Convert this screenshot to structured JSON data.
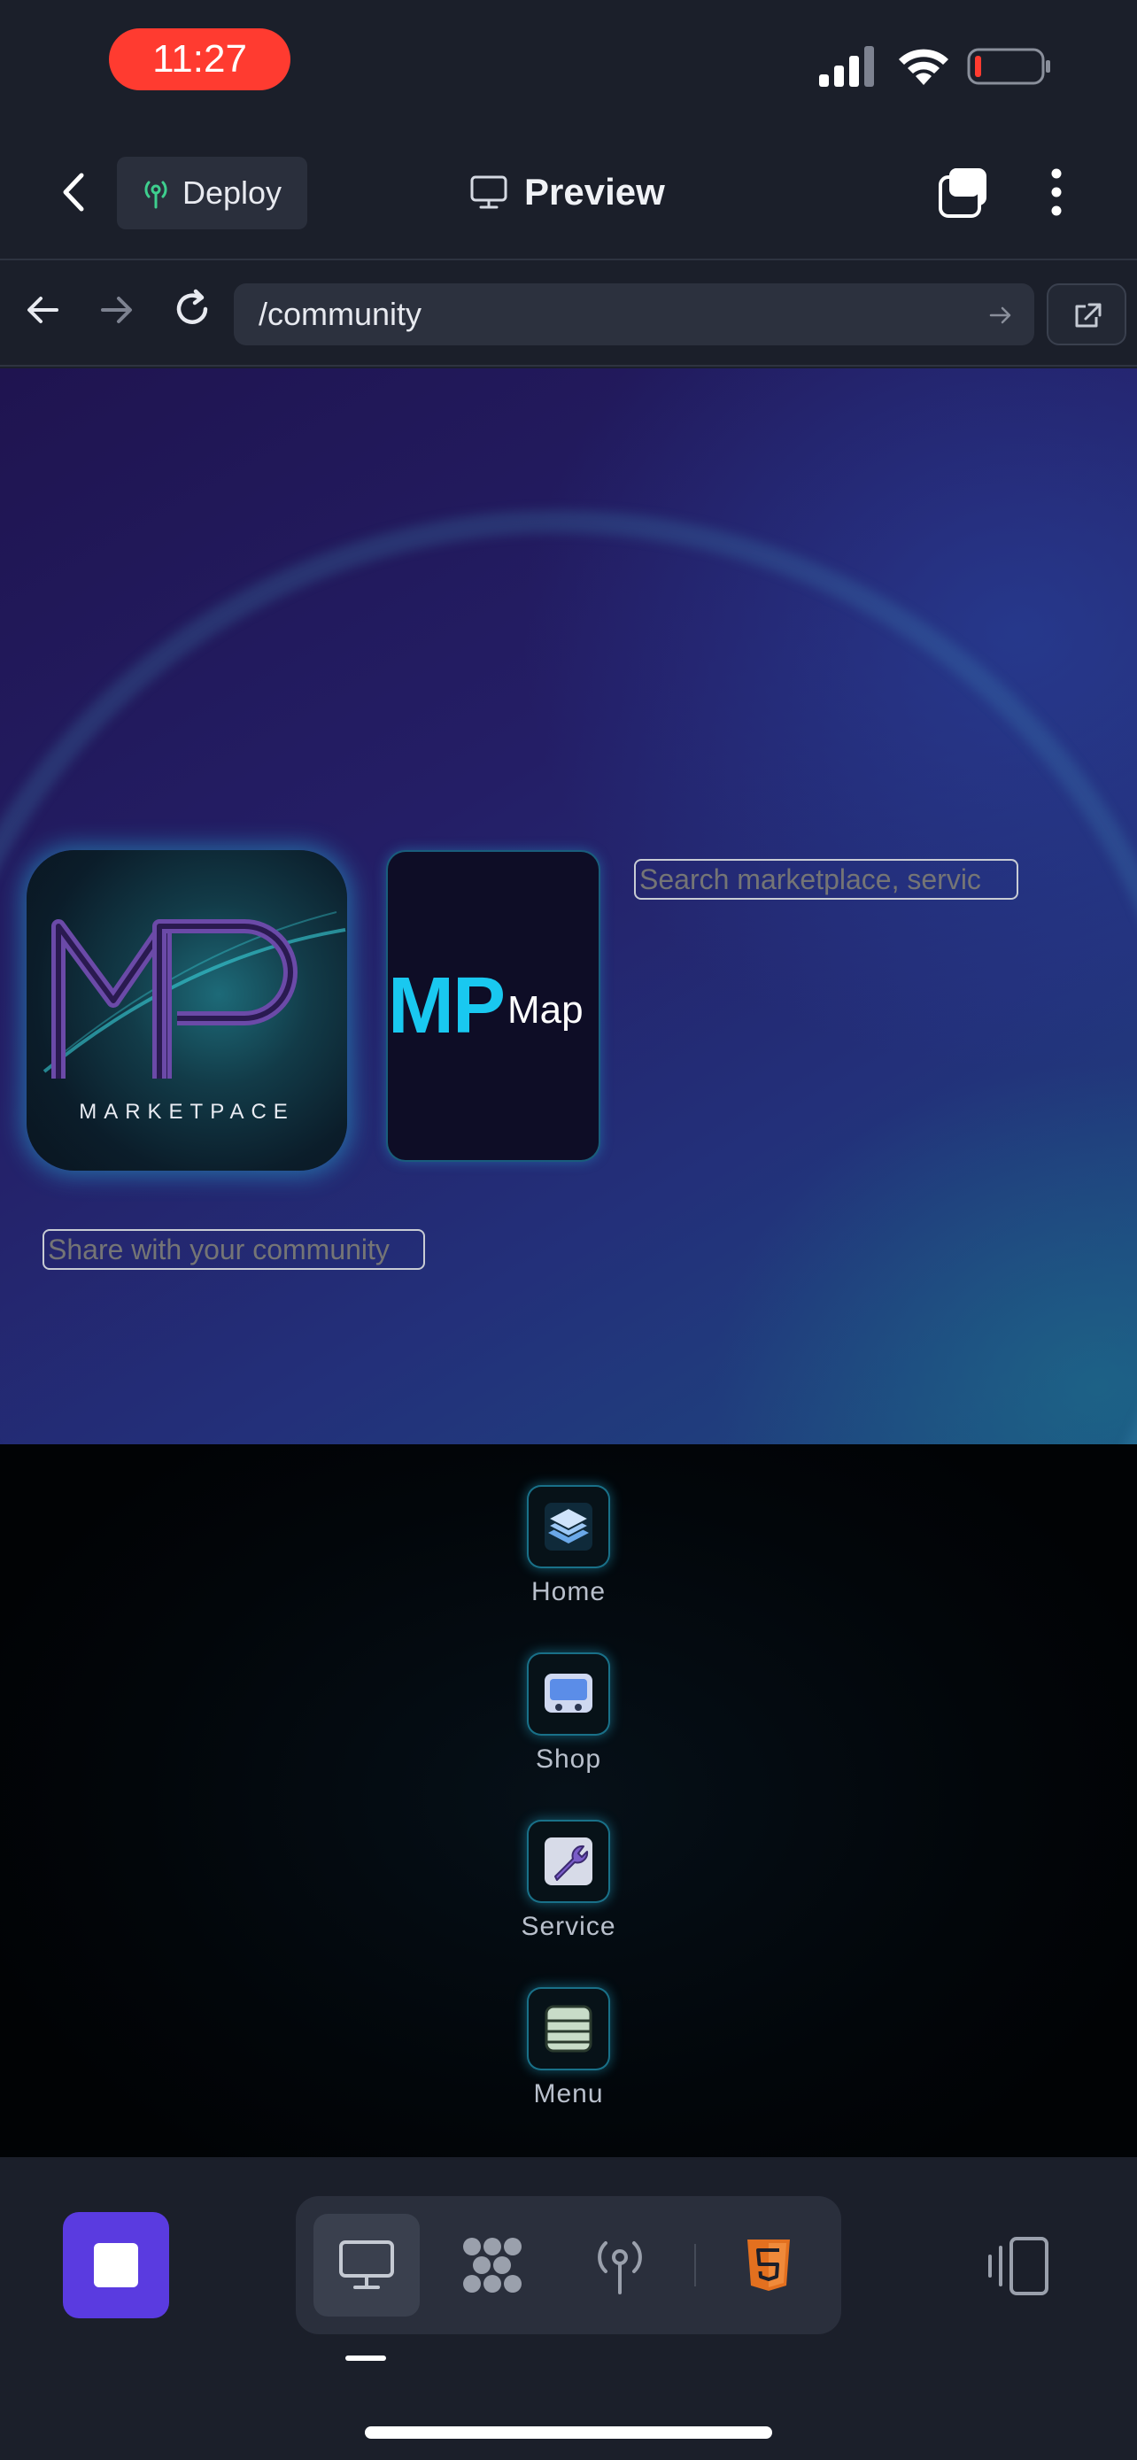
{
  "status_bar": {
    "time": "11:27",
    "icons": [
      "cellular-signal-icon",
      "wifi-icon",
      "battery-low-icon"
    ]
  },
  "app_bar": {
    "back_icon": "chevron-left-icon",
    "deploy_label": "Deploy",
    "deploy_icon": "deploy-antenna-icon",
    "title": "Preview",
    "title_icon": "monitor-icon",
    "tabs_icon": "tabs-icon",
    "more_icon": "more-vertical-icon"
  },
  "url_bar": {
    "url": "/community",
    "back_icon": "arrow-left-icon",
    "forward_icon": "arrow-right-icon",
    "reload_icon": "reload-icon",
    "go_icon": "arrow-right-small-icon",
    "open_external_icon": "open-external-icon"
  },
  "web_page": {
    "logo_text": "MARKETPACE",
    "mp_map": {
      "mp": "MP",
      "map": "Map"
    },
    "search_placeholder": "Search marketplace, servic",
    "share_placeholder": "Share with your community",
    "nav": [
      {
        "label": "Home",
        "icon": "layers-icon"
      },
      {
        "label": "Shop",
        "icon": "cart-icon"
      },
      {
        "label": "Service",
        "icon": "wrench-icon"
      },
      {
        "label": "Menu",
        "icon": "menu-list-icon"
      }
    ]
  },
  "toolbar": {
    "stop_icon": "stop-icon",
    "segments": [
      {
        "name": "desktop-preview",
        "icon": "monitor-icon",
        "active": true
      },
      {
        "name": "agent",
        "icon": "agent-grid-icon",
        "active": false
      },
      {
        "name": "deploy",
        "icon": "deploy-antenna-icon",
        "active": false
      },
      {
        "name": "html",
        "icon": "html5-icon",
        "active": false
      }
    ],
    "device_icon": "device-switch-icon"
  },
  "colors": {
    "accent": "#5a3be0",
    "time_pill": "#ff3b30",
    "mp_cyan": "#19c8f0",
    "html_orange": "#e3701f",
    "deploy_green": "#3ecf8e"
  }
}
